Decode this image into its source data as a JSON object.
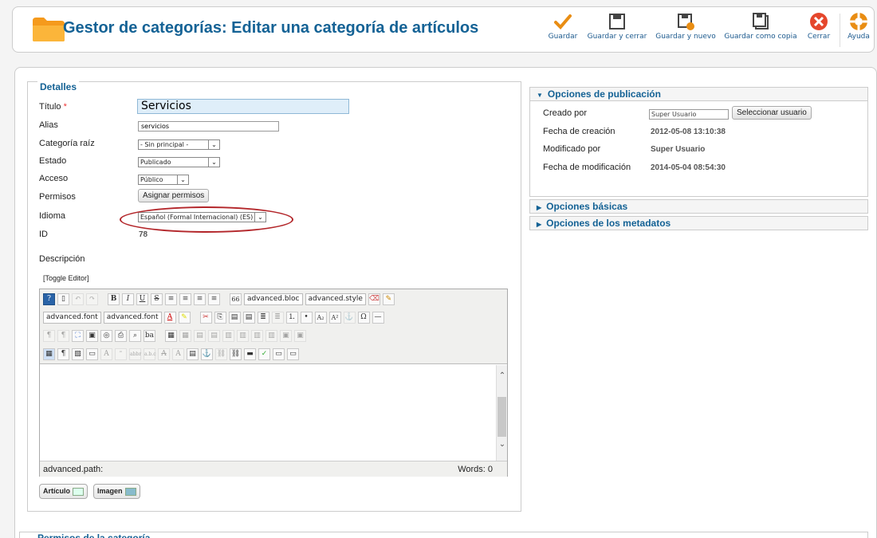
{
  "header": {
    "title": "Gestor de categorías: Editar una categoría de artículos",
    "toolbar": [
      {
        "label": "Guardar",
        "icon": "check-icon"
      },
      {
        "label": "Guardar y cerrar",
        "icon": "save-close-icon"
      },
      {
        "label": "Guardar y nuevo",
        "icon": "save-new-icon"
      },
      {
        "label": "Guardar como copia",
        "icon": "save-copy-icon"
      },
      {
        "label": "Cerrar",
        "icon": "close-icon"
      },
      {
        "label": "Ayuda",
        "icon": "help-icon"
      }
    ]
  },
  "details": {
    "legend": "Detalles",
    "title_label": "Título",
    "required_mark": "*",
    "title_value": "Servicios",
    "alias_label": "Alias",
    "alias_value": "servicios",
    "parent_label": "Categoría raíz",
    "parent_value": "- Sin principal -",
    "state_label": "Estado",
    "state_value": "Publicado",
    "access_label": "Acceso",
    "access_value": "Público",
    "permissions_label": "Permisos",
    "permissions_button": "Asignar permisos",
    "language_label": "Idioma",
    "language_value": "Español (Formal Internacional) (ES)",
    "id_label": "ID",
    "id_value": "78",
    "description_label": "Descripción",
    "toggle_editor": "[Toggle Editor]"
  },
  "editor": {
    "block_select": "advanced.bloc",
    "style_select": "advanced.style",
    "font_select": "advanced.font",
    "size_select": "advanced.font",
    "path_label": "advanced.path:",
    "words": "Words: 0",
    "buttons": {
      "bold": "B",
      "italic": "I",
      "underline": "U",
      "strike": "S",
      "blockquote": "66",
      "subscript": "A₂",
      "superscript": "A²",
      "omega": "Ω",
      "pilcrow": "¶",
      "abbr": "‴"
    }
  },
  "extra_buttons": [
    {
      "label": "Artículo"
    },
    {
      "label": "Imagen"
    }
  ],
  "publishing": {
    "header": "Opciones de publicación",
    "created_by_label": "Creado por",
    "created_by_value": "Super Usuario",
    "select_user_button": "Seleccionar usuario",
    "created_date_label": "Fecha de creación",
    "created_date_value": "2012-05-08 13:10:38",
    "modified_by_label": "Modificado por",
    "modified_by_value": "Super Usuario",
    "modified_date_label": "Fecha de modificación",
    "modified_date_value": "2014-05-04 08:54:30"
  },
  "basic_options": {
    "header": "Opciones básicas"
  },
  "metadata_options": {
    "header": "Opciones de los metadatos"
  },
  "category_permissions": {
    "legend": "Permisos de la categoría"
  },
  "colors": {
    "title_blue": "#146295",
    "annotation_red": "#b3262a",
    "title_input_bg": "#dfeef9"
  }
}
